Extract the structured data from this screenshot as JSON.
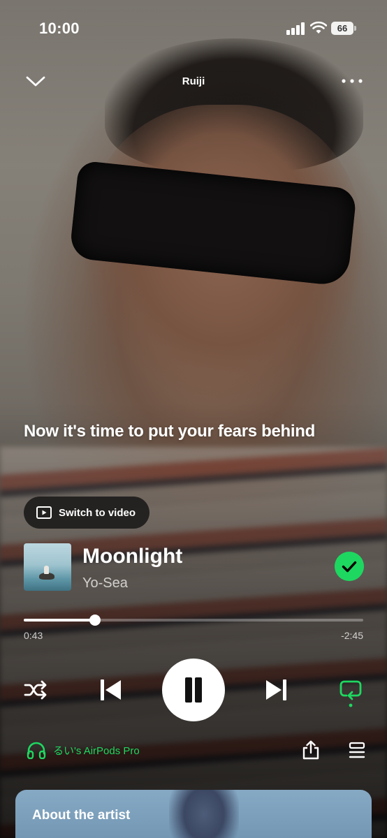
{
  "status_bar": {
    "time": "10:00",
    "battery": "66"
  },
  "header": {
    "context_title": "Ruiji"
  },
  "lyric": "Now it's time to put your fears behind",
  "switch_video": {
    "label": "Switch to video"
  },
  "track": {
    "title": "Moonlight",
    "artist": "Yo-Sea",
    "saved": true
  },
  "playback": {
    "elapsed": "0:43",
    "remaining": "-2:45",
    "progress": 0.21,
    "state": "playing"
  },
  "controls": {
    "shuffle": "shuffle-icon",
    "previous": "skip-previous-icon",
    "play_pause": "pause-icon",
    "next": "skip-next-icon",
    "repeat": "repeat-icon"
  },
  "device": {
    "name": "るい's AirPods Pro",
    "icon": "headphones-icon"
  },
  "about_card": {
    "label": "About the artist"
  },
  "colors": {
    "accent": "#1ed760",
    "text": "#ffffff",
    "button_bg": "#ffffff"
  }
}
